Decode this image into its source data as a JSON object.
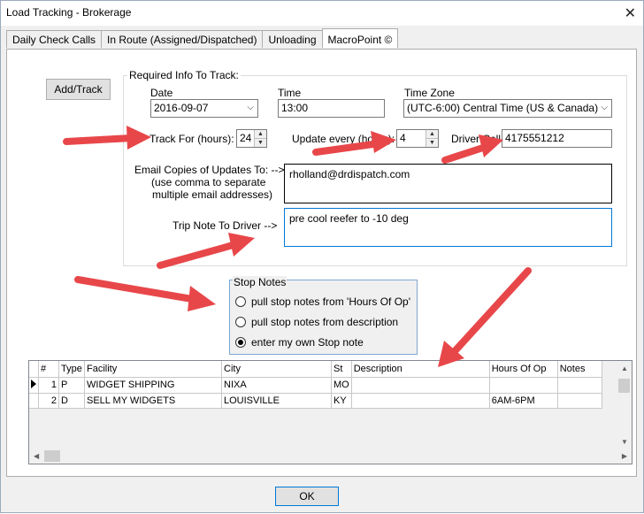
{
  "window": {
    "title": "Load Tracking - Brokerage",
    "close_glyph": "✕"
  },
  "tabs": [
    {
      "label": "Daily Check Calls"
    },
    {
      "label": "In Route (Assigned/Dispatched)"
    },
    {
      "label": "Unloading"
    },
    {
      "label": "MacroPoint ©"
    }
  ],
  "buttons": {
    "add_track": "Add/Track",
    "ok": "OK"
  },
  "required": {
    "group_label": "Required Info To Track:",
    "date_label": "Date",
    "date_value": "2016-09-07",
    "time_label": "Time",
    "time_value": "13:00",
    "tz_label": "Time Zone",
    "tz_value": "(UTC-6:00) Central Time (US & Canada)",
    "track_for_label": "Track For (hours):",
    "track_for_value": "24",
    "update_label": "Update every (hours):",
    "update_value": "4",
    "cell_label": "Driver Cell:",
    "cell_value": "4175551212",
    "email_label_1": "Email Copies of Updates To: -->",
    "email_label_2": "(use comma to separate",
    "email_label_3": "multiple email addresses)",
    "email_value": "rholland@drdispatch.com",
    "trip_note_label": "Trip Note To Driver -->",
    "trip_note_value": "pre cool reefer to -10 deg"
  },
  "stop_notes": {
    "label": "Stop Notes",
    "options": [
      {
        "label": "pull stop notes from 'Hours Of Op'",
        "checked": false
      },
      {
        "label": "pull stop notes from description",
        "checked": false
      },
      {
        "label": "enter my own Stop note",
        "checked": true
      }
    ]
  },
  "grid": {
    "columns": [
      "#",
      "Type",
      "Facility",
      "City",
      "St",
      "Description",
      "Hours Of Op",
      "Notes"
    ],
    "rows": [
      [
        "1",
        "P",
        "WIDGET SHIPPING",
        "NIXA",
        "MO",
        "",
        "",
        ""
      ],
      [
        "2",
        "D",
        "SELL MY WIDGETS",
        "LOUISVILLE",
        "KY",
        "",
        "6AM-6PM",
        ""
      ]
    ]
  },
  "colors": {
    "arrow": "#e8474a",
    "stop_group_border": "#7fa7d3"
  }
}
